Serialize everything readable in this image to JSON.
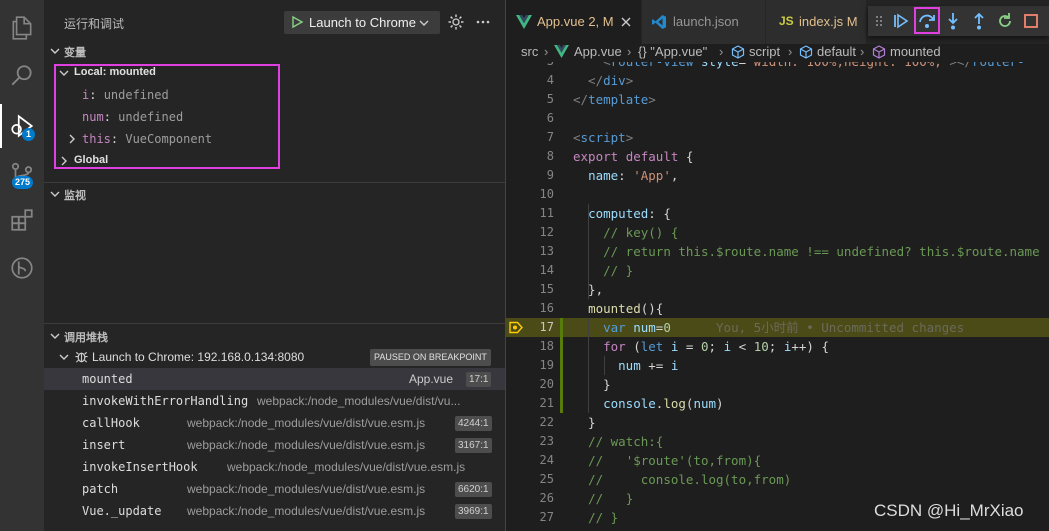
{
  "sidebar": {
    "title": "运行和调试",
    "launch_config": "Launch to Chrome",
    "variables": {
      "header": "变量",
      "local_scope": "Local: mounted",
      "items": [
        {
          "name": "i",
          "value": "undefined"
        },
        {
          "name": "num",
          "value": "undefined"
        },
        {
          "name": "this",
          "value": "VueComponent"
        }
      ],
      "global_scope": "Global"
    },
    "watch": {
      "header": "监视"
    },
    "call_stack": {
      "header": "调用堆栈",
      "session": "Launch to Chrome: 192.168.0.134:8080",
      "status": "PAUSED ON BREAKPOINT",
      "frames": [
        {
          "fn": "mounted",
          "source": "App.vue",
          "line": "17:1"
        },
        {
          "fn": "invokeWithErrorHandling",
          "source": "webpack:/node_modules/vue/dist/vu...",
          "line": ""
        },
        {
          "fn": "callHook",
          "source": "webpack:/node_modules/vue/dist/vue.esm.js",
          "line": "4244:1"
        },
        {
          "fn": "insert",
          "source": "webpack:/node_modules/vue/dist/vue.esm.js",
          "line": "3167:1"
        },
        {
          "fn": "invokeInsertHook",
          "source": "webpack:/node_modules/vue/dist/vue.esm.js",
          "line": ""
        },
        {
          "fn": "patch",
          "source": "webpack:/node_modules/vue/dist/vue.esm.js",
          "line": "6620:1"
        },
        {
          "fn": "Vue._update",
          "source": "webpack:/node_modules/vue/dist/vue.esm.js",
          "line": "3969:1"
        }
      ]
    }
  },
  "activity": {
    "debug_badge": "1",
    "scm_badge": "275"
  },
  "tabs": [
    {
      "label": "App.vue",
      "status": "2, M"
    },
    {
      "label": "launch.json",
      "status": ""
    },
    {
      "label": "index.js",
      "status": "M"
    }
  ],
  "breadcrumb": [
    "src",
    "App.vue",
    "{} \"App.vue\"",
    "script",
    "default",
    "mounted"
  ],
  "editor": {
    "blame": "You, 5小时前 • Uncommitted changes",
    "lines": [
      {
        "no": "3",
        "text": "    <router-view style=\"width: 100%;height: 100%;\"></router-"
      },
      {
        "no": "4",
        "text": "  </div>"
      },
      {
        "no": "5",
        "text": "</template>"
      },
      {
        "no": "6",
        "text": ""
      },
      {
        "no": "7",
        "text": "<script>"
      },
      {
        "no": "8",
        "text": "export default {"
      },
      {
        "no": "9",
        "text": "  name: 'App',"
      },
      {
        "no": "10",
        "text": ""
      },
      {
        "no": "11",
        "text": "  computed: {"
      },
      {
        "no": "12",
        "text": "    // key() {"
      },
      {
        "no": "13",
        "text": "    // return this.$route.name !== undefined? this.$route.name"
      },
      {
        "no": "14",
        "text": "    // }"
      },
      {
        "no": "15",
        "text": "  },"
      },
      {
        "no": "16",
        "text": "  mounted(){"
      },
      {
        "no": "17",
        "text": "    var num=0"
      },
      {
        "no": "18",
        "text": "    for (let i = 0; i < 10; i++) {"
      },
      {
        "no": "19",
        "text": "      num += i"
      },
      {
        "no": "20",
        "text": "    }"
      },
      {
        "no": "21",
        "text": "    console.log(num)"
      },
      {
        "no": "22",
        "text": "  }"
      },
      {
        "no": "23",
        "text": "  // watch:{"
      },
      {
        "no": "24",
        "text": "  //   '$route'(to,from){"
      },
      {
        "no": "25",
        "text": "  //     console.log(to,from)"
      },
      {
        "no": "26",
        "text": "  //   }"
      },
      {
        "no": "27",
        "text": "  // }"
      }
    ]
  },
  "watermark": "CSDN @Hi_MrXiao"
}
